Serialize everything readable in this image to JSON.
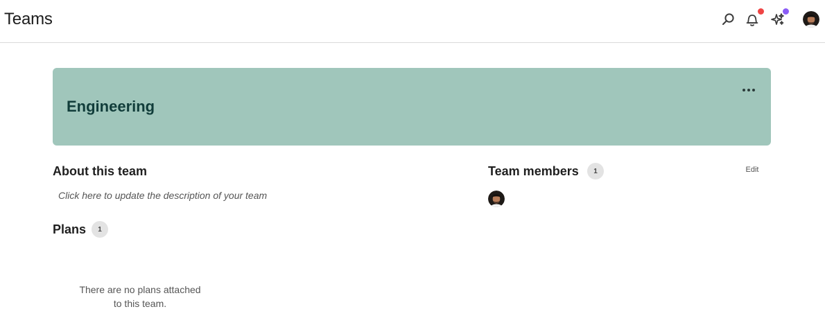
{
  "header": {
    "title": "Teams",
    "icons": {
      "search": "search-icon",
      "notifications": "bell-icon",
      "ai": "sparkle-icon",
      "profile": "avatar"
    },
    "notification_dot_color": "#ef4444",
    "ai_dot_color": "#8b5cf6"
  },
  "team": {
    "name": "Engineering",
    "banner_color": "#a0c6bb",
    "name_color": "#113d3a",
    "menu_icon": "more-horizontal-icon"
  },
  "about": {
    "heading": "About this team",
    "description_placeholder": "Click here to update the description of your team"
  },
  "plans": {
    "heading": "Plans",
    "count": "1",
    "empty_line_1": "There are no plans attached",
    "empty_line_2": "to this team."
  },
  "members": {
    "heading": "Team members",
    "count": "1",
    "edit_label": "Edit"
  }
}
